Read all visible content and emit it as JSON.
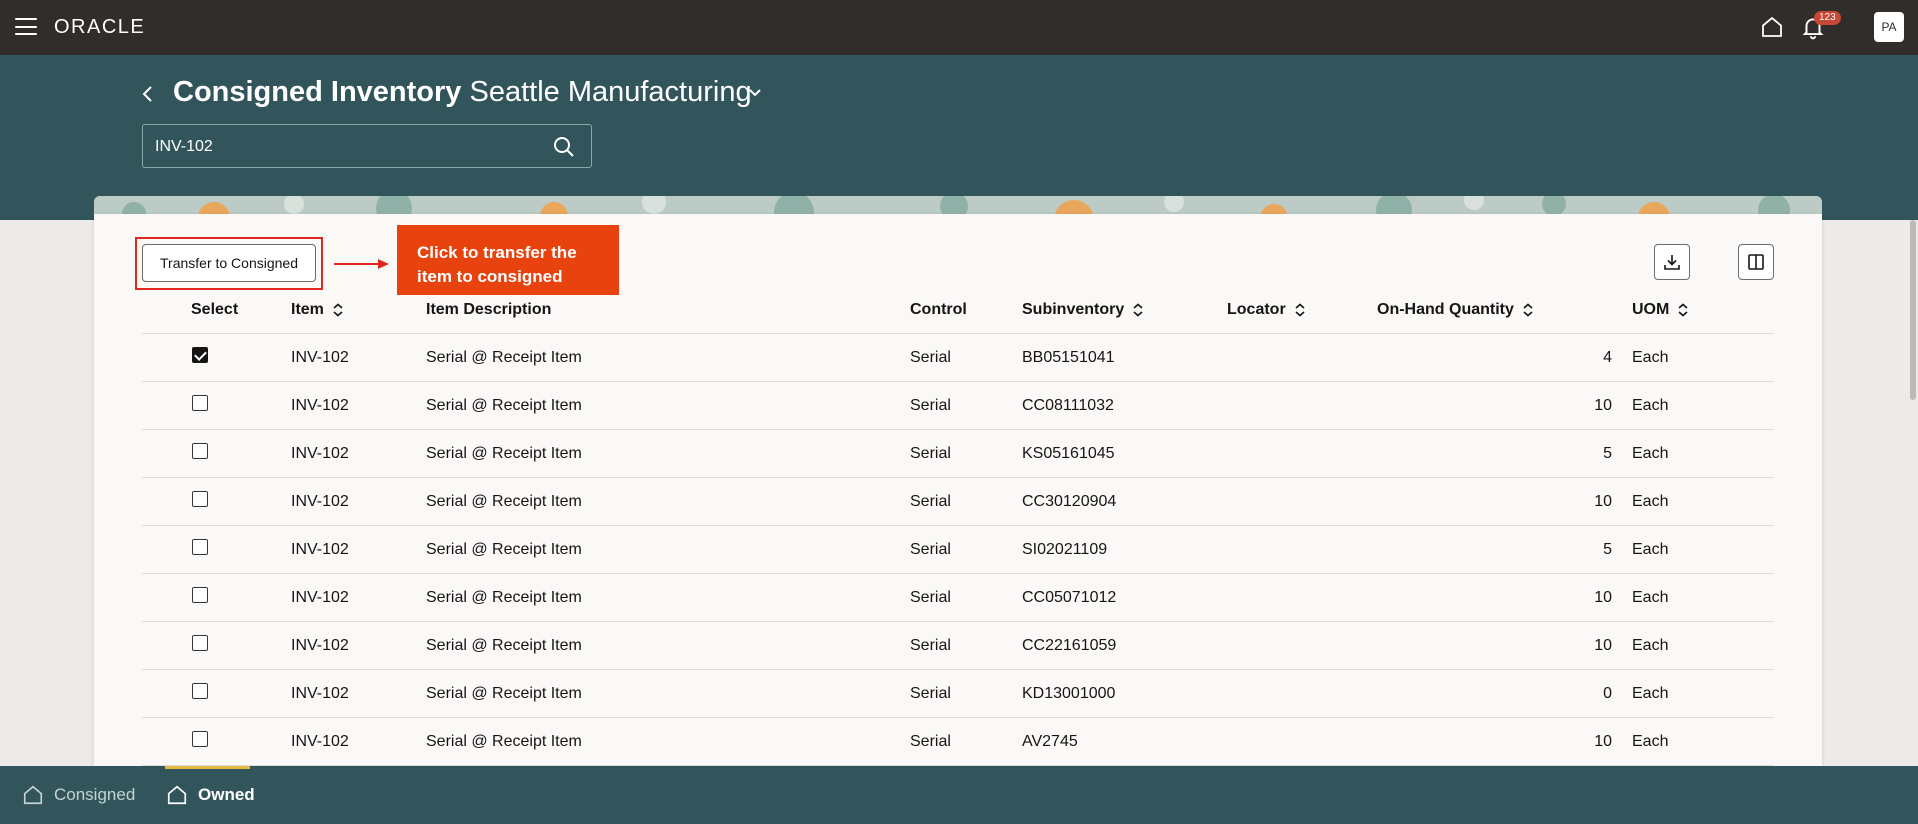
{
  "app": {
    "logo": "ORACLE",
    "notifications_count": "123",
    "avatar_initials": "PA"
  },
  "header": {
    "title_bold": "Consigned Inventory",
    "title_org": "Seattle Manufacturing"
  },
  "search": {
    "value": "INV-102"
  },
  "toolbar": {
    "transfer_label": "Transfer to Consigned"
  },
  "callout": {
    "text": "Click to transfer the item to consigned"
  },
  "colors": {
    "accent": "#e8420e",
    "header_band": "#32555b",
    "top_bar": "#312d2a"
  },
  "table": {
    "columns": {
      "select": "Select",
      "item": "Item",
      "description": "Item Description",
      "control": "Control",
      "subinventory": "Subinventory",
      "locator": "Locator",
      "quantity": "On-Hand Quantity",
      "uom": "UOM"
    },
    "rows": [
      {
        "selected": true,
        "item": "INV-102",
        "description": "Serial @ Receipt Item",
        "control": "Serial",
        "subinventory": "BB05151041",
        "locator": "",
        "quantity": "4",
        "uom": "Each"
      },
      {
        "selected": false,
        "item": "INV-102",
        "description": "Serial @ Receipt Item",
        "control": "Serial",
        "subinventory": "CC08111032",
        "locator": "",
        "quantity": "10",
        "uom": "Each"
      },
      {
        "selected": false,
        "item": "INV-102",
        "description": "Serial @ Receipt Item",
        "control": "Serial",
        "subinventory": "KS05161045",
        "locator": "",
        "quantity": "5",
        "uom": "Each"
      },
      {
        "selected": false,
        "item": "INV-102",
        "description": "Serial @ Receipt Item",
        "control": "Serial",
        "subinventory": "CC30120904",
        "locator": "",
        "quantity": "10",
        "uom": "Each"
      },
      {
        "selected": false,
        "item": "INV-102",
        "description": "Serial @ Receipt Item",
        "control": "Serial",
        "subinventory": "SI02021109",
        "locator": "",
        "quantity": "5",
        "uom": "Each"
      },
      {
        "selected": false,
        "item": "INV-102",
        "description": "Serial @ Receipt Item",
        "control": "Serial",
        "subinventory": "CC05071012",
        "locator": "",
        "quantity": "10",
        "uom": "Each"
      },
      {
        "selected": false,
        "item": "INV-102",
        "description": "Serial @ Receipt Item",
        "control": "Serial",
        "subinventory": "CC22161059",
        "locator": "",
        "quantity": "10",
        "uom": "Each"
      },
      {
        "selected": false,
        "item": "INV-102",
        "description": "Serial @ Receipt Item",
        "control": "Serial",
        "subinventory": "KD13001000",
        "locator": "",
        "quantity": "0",
        "uom": "Each"
      },
      {
        "selected": false,
        "item": "INV-102",
        "description": "Serial @ Receipt Item",
        "control": "Serial",
        "subinventory": "AV2745",
        "locator": "",
        "quantity": "10",
        "uom": "Each"
      }
    ]
  },
  "bottom_nav": {
    "consigned_label": "Consigned",
    "owned_label": "Owned"
  }
}
